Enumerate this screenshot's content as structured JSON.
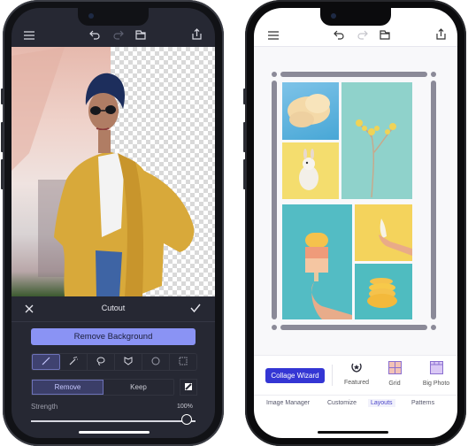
{
  "left_phone": {
    "toolbar": {
      "icons": [
        "menu-icon",
        "undo-icon",
        "redo-icon",
        "layers-icon",
        "share-icon"
      ]
    },
    "cutout": {
      "title": "Cutout",
      "close_icon": "close-icon",
      "confirm_icon": "checkmark-icon"
    },
    "remove_background_label": "Remove Background",
    "tools": [
      {
        "name": "brush",
        "icon": "brush-icon",
        "active": true
      },
      {
        "name": "magic-wand",
        "icon": "magic-wand-icon",
        "active": false
      },
      {
        "name": "lasso",
        "icon": "lasso-icon",
        "active": false
      },
      {
        "name": "face-mask",
        "icon": "mask-icon",
        "active": false
      },
      {
        "name": "ellipse",
        "icon": "ellipse-select-icon",
        "active": false
      },
      {
        "name": "rectangle",
        "icon": "rect-select-icon",
        "active": false
      }
    ],
    "mode": {
      "options": [
        "Remove",
        "Keep"
      ],
      "selected": "Remove"
    },
    "strength": {
      "label": "Strength",
      "value_text": "100%",
      "value": 100
    },
    "colors": {
      "accent": "#8a93f4",
      "panel": "#262833",
      "active_tool": "#3f4270"
    }
  },
  "right_phone": {
    "toolbar": {
      "icons": [
        "menu-icon",
        "undo-icon",
        "redo-icon",
        "layers-icon",
        "share-icon"
      ]
    },
    "collage": {
      "photos": [
        "clouds",
        "dried-flower",
        "bunny",
        "popsicle",
        "banana",
        "orange-slices"
      ]
    },
    "layout_bar": {
      "wizard_label": "Collage Wizard",
      "items": [
        {
          "label": "Featured",
          "icon": "laurel-star-icon"
        },
        {
          "label": "Grid",
          "icon": "grid-icon"
        },
        {
          "label": "Big Photo",
          "icon": "big-photo-icon"
        }
      ]
    },
    "tabs": [
      {
        "label": "Image Manager",
        "active": false
      },
      {
        "label": "Customize",
        "active": false
      },
      {
        "label": "Layouts",
        "active": true
      },
      {
        "label": "Patterns",
        "active": false
      }
    ],
    "colors": {
      "accent": "#3436d4",
      "active_tab": "#4a45c9",
      "rail": "#8b8a98"
    }
  }
}
